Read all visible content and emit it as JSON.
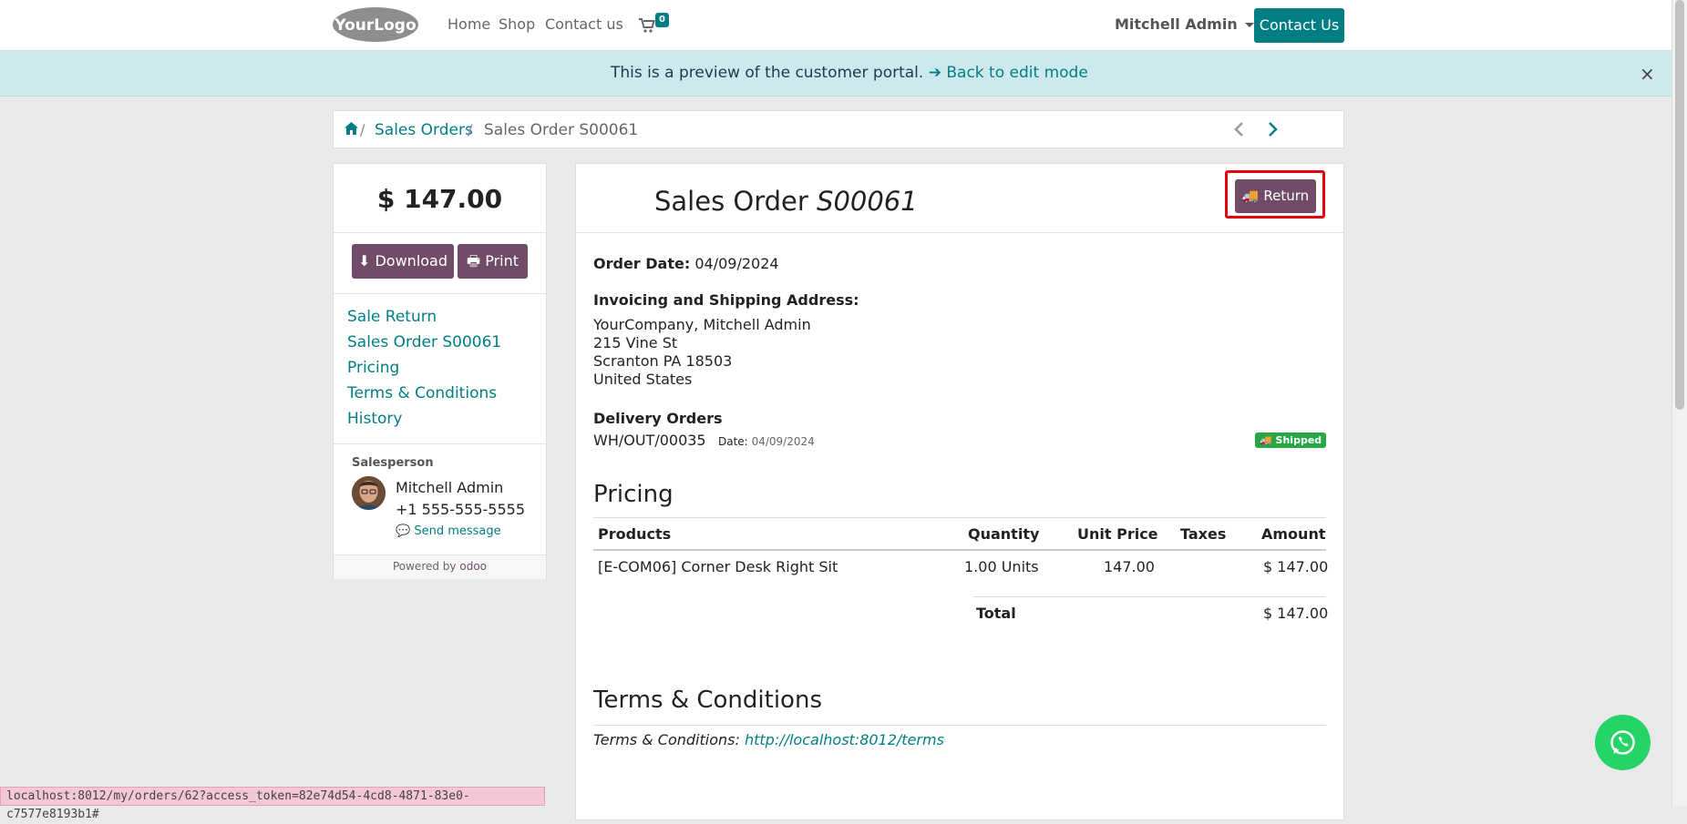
{
  "nav": {
    "logo_text": "YourLogo",
    "links": [
      "Home",
      "Shop",
      "Contact us"
    ],
    "cart_count": "0",
    "user": "Mitchell Admin",
    "contact_button": "Contact Us"
  },
  "preview": {
    "text": "This is a preview of the customer portal.",
    "link": "Back to edit mode",
    "close": "×"
  },
  "breadcrumb": {
    "items": [
      "Sales Orders",
      "Sales Order S00061"
    ],
    "separator": "/"
  },
  "sidebar": {
    "amount": "$ 147.00",
    "download_label": "Download",
    "print_label": "Print",
    "links": [
      "Sale Return",
      "Sales Order S00061",
      "Pricing",
      "Terms & Conditions",
      "History"
    ],
    "salesperson_label": "Salesperson",
    "salesperson_name": "Mitchell Admin",
    "salesperson_phone": "+1 555-555-5555",
    "send_message": "Send message",
    "powered_by": "Powered by",
    "powered_brand": "odoo"
  },
  "order": {
    "title_prefix": "Sales Order",
    "number": "S00061",
    "return_label": "Return",
    "order_date_label": "Order Date:",
    "order_date": "04/09/2024",
    "address_label": "Invoicing and Shipping Address:",
    "address_lines": [
      "YourCompany, Mitchell Admin",
      "215 Vine St",
      "Scranton PA 18503",
      "United States"
    ],
    "delivery_label": "Delivery Orders",
    "delivery_ref": "WH/OUT/00035",
    "delivery_date_label": "Date:",
    "delivery_date": "04/09/2024",
    "delivery_status": "Shipped"
  },
  "pricing": {
    "heading": "Pricing",
    "columns": [
      "Products",
      "Quantity",
      "Unit Price",
      "Taxes",
      "Amount"
    ],
    "rows": [
      {
        "product": "[E-COM06] Corner Desk Right Sit",
        "quantity": "1.00 Units",
        "unit_price": "147.00",
        "taxes": "",
        "amount": "$ 147.00"
      }
    ],
    "total_label": "Total",
    "total_value": "$ 147.00"
  },
  "terms": {
    "heading": "Terms & Conditions",
    "label": "Terms & Conditions:",
    "url": "http://localhost:8012/terms"
  },
  "status_url": "localhost:8012/my/orders/62?access_token=82e74d54-4cd8-4871-83e0-c7577e8193b1#",
  "colors": {
    "brand_teal": "#017e84",
    "odoo_purple": "#714b67",
    "shipped_green": "#28a745",
    "highlight_red": "#e8000b",
    "whatsapp": "#25d366"
  }
}
